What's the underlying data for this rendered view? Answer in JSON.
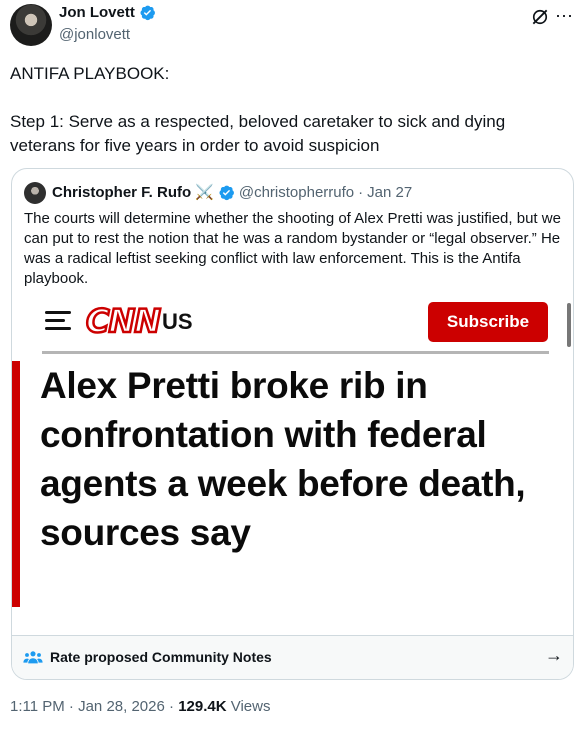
{
  "author": {
    "display_name": "Jon Lovett",
    "handle": "@jonlovett",
    "verified_icon": "verified-badge-icon"
  },
  "actions": {
    "grok_icon": "grok-slash-icon"
  },
  "tweet": {
    "text": "ANTIFA PLAYBOOK:\n\nStep 1: Serve as a respected, beloved caretaker to sick and dying veterans for five years in order to avoid suspicion"
  },
  "quoted": {
    "display_name": "Christopher F. Rufo",
    "emoji": "⚔️",
    "handle": "@christopherrufo",
    "separator": "·",
    "date": "Jan 27",
    "text": "The courts will determine whether the shooting of Alex Pretti was justified, but we can put to rest the notion that he was a random bystander or “legal observer.” He was a radical leftist seeking conflict with law enforcement. This is the Antifa playbook.",
    "media": {
      "logo": "CNN",
      "edition": "US",
      "subscribe": "Subscribe",
      "headline": "Alex Pretti broke rib in confrontation with federal agents a week before death, sources say",
      "brand_color": "#cc0000"
    }
  },
  "community_notes": {
    "label": "Rate proposed Community Notes",
    "arrow": "→"
  },
  "footer": {
    "time": "1:11 PM",
    "dot": "·",
    "date": "Jan 28, 2026",
    "views_count": "129.4K",
    "views_label": "Views"
  },
  "colors": {
    "text": "#0f1419",
    "secondary": "#536471",
    "verified": "#1d9bf0",
    "border": "#cfd9de"
  }
}
